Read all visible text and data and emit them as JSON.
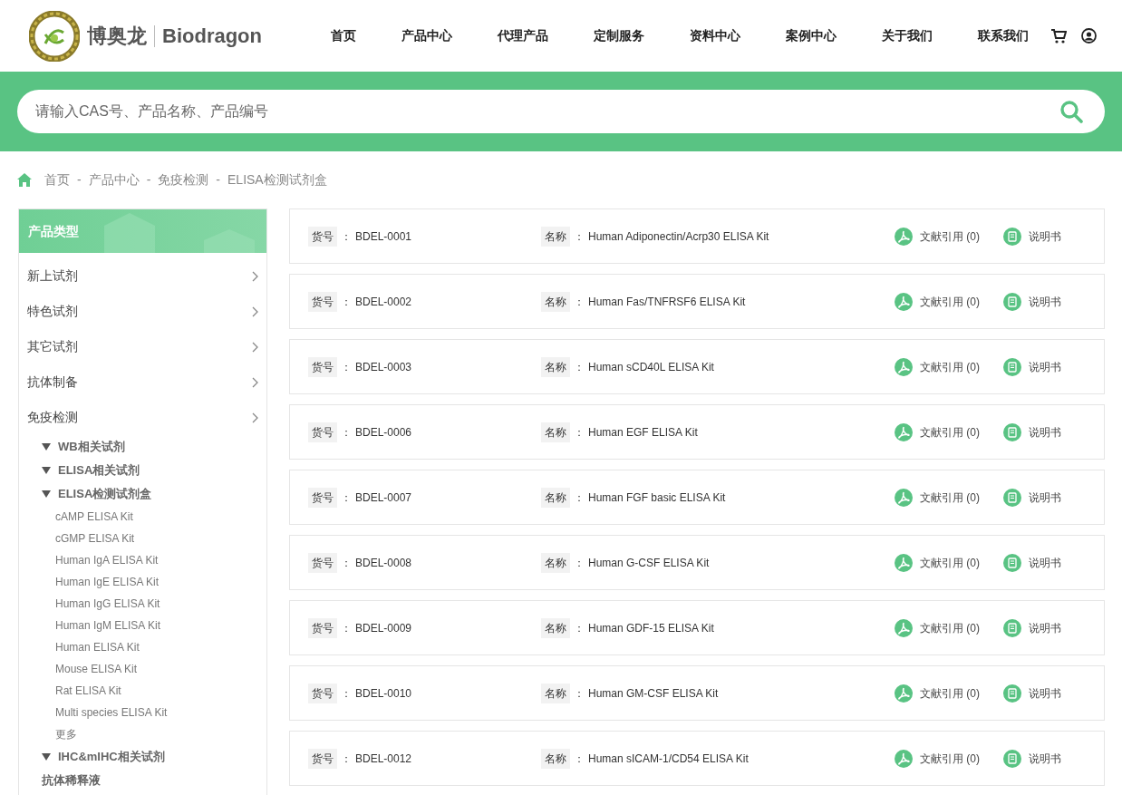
{
  "header": {
    "brand_cn": "博奥龙",
    "brand_en": "Biodragon",
    "nav": [
      {
        "label": "首页"
      },
      {
        "label": "产品中心"
      },
      {
        "label": "代理产品"
      },
      {
        "label": "定制服务"
      },
      {
        "label": "资料中心"
      },
      {
        "label": "案例中心"
      },
      {
        "label": "关于我们"
      },
      {
        "label": "联系我们"
      }
    ]
  },
  "search": {
    "placeholder": "请输入CAS号、产品名称、产品编号"
  },
  "breadcrumb": [
    {
      "label": "首页"
    },
    {
      "separator": "-",
      "label": "产品中心"
    },
    {
      "separator": "-",
      "label": "免疫检测"
    },
    {
      "separator": "-",
      "label": "ELISA检测试剂盒"
    }
  ],
  "sidebar": {
    "title": "产品类型",
    "items": [
      {
        "label": "新上试剂"
      },
      {
        "label": "特色试剂"
      },
      {
        "label": "其它试剂"
      },
      {
        "label": "抗体制备"
      },
      {
        "label": "免疫检测",
        "children": [
          {
            "label": "WB相关试剂",
            "expanded": true
          },
          {
            "label": "ELISA相关试剂",
            "expanded": true
          },
          {
            "label": "ELISA检测试剂盒",
            "expanded": true,
            "children": [
              {
                "label": "cAMP ELISA Kit"
              },
              {
                "label": "cGMP ELISA Kit"
              },
              {
                "label": "Human IgA ELISA Kit"
              },
              {
                "label": "Human IgE ELISA Kit"
              },
              {
                "label": "Human IgG ELISA Kit"
              },
              {
                "label": "Human IgM ELISA Kit"
              },
              {
                "label": "Human ELISA Kit"
              },
              {
                "label": "Mouse ELISA Kit"
              },
              {
                "label": "Rat ELISA Kit"
              },
              {
                "label": "Multi species ELISA Kit"
              },
              {
                "label": "更多"
              }
            ]
          },
          {
            "label": "IHC&mIHC相关试剂",
            "expanded": true
          },
          {
            "label": "抗体稀释液"
          }
        ]
      }
    ]
  },
  "products": [
    {
      "code_label": "货号",
      "code_colon": "：",
      "code": "BDEL-0001",
      "name_label": "名称",
      "name_colon": "：",
      "name": "Human Adiponectin/Acrp30 ELISA Kit",
      "citations": "文献引用 (0)",
      "manual": "说明书"
    },
    {
      "code_label": "货号",
      "code_colon": "：",
      "code": "BDEL-0002",
      "name_label": "名称",
      "name_colon": "：",
      "name": "Human Fas/TNFRSF6 ELISA Kit",
      "citations": "文献引用 (0)",
      "manual": "说明书"
    },
    {
      "code_label": "货号",
      "code_colon": "：",
      "code": "BDEL-0003",
      "name_label": "名称",
      "name_colon": "：",
      "name": "Human sCD40L ELISA Kit",
      "citations": "文献引用 (0)",
      "manual": "说明书"
    },
    {
      "code_label": "货号",
      "code_colon": "：",
      "code": "BDEL-0006",
      "name_label": "名称",
      "name_colon": "：",
      "name": "Human EGF ELISA Kit",
      "citations": "文献引用 (0)",
      "manual": "说明书"
    },
    {
      "code_label": "货号",
      "code_colon": "：",
      "code": "BDEL-0007",
      "name_label": "名称",
      "name_colon": "：",
      "name": "Human FGF basic ELISA Kit",
      "citations": "文献引用 (0)",
      "manual": "说明书"
    },
    {
      "code_label": "货号",
      "code_colon": "：",
      "code": "BDEL-0008",
      "name_label": "名称",
      "name_colon": "：",
      "name": "Human G-CSF ELISA Kit",
      "citations": "文献引用 (0)",
      "manual": "说明书"
    },
    {
      "code_label": "货号",
      "code_colon": "：",
      "code": "BDEL-0009",
      "name_label": "名称",
      "name_colon": "：",
      "name": "Human GDF-15 ELISA Kit",
      "citations": "文献引用 (0)",
      "manual": "说明书"
    },
    {
      "code_label": "货号",
      "code_colon": "：",
      "code": "BDEL-0010",
      "name_label": "名称",
      "name_colon": "：",
      "name": "Human GM-CSF ELISA Kit",
      "citations": "文献引用 (0)",
      "manual": "说明书"
    },
    {
      "code_label": "货号",
      "code_colon": "：",
      "code": "BDEL-0012",
      "name_label": "名称",
      "name_colon": "：",
      "name": "Human sICAM-1/CD54 ELISA Kit",
      "citations": "文献引用 (0)",
      "manual": "说明书"
    }
  ]
}
